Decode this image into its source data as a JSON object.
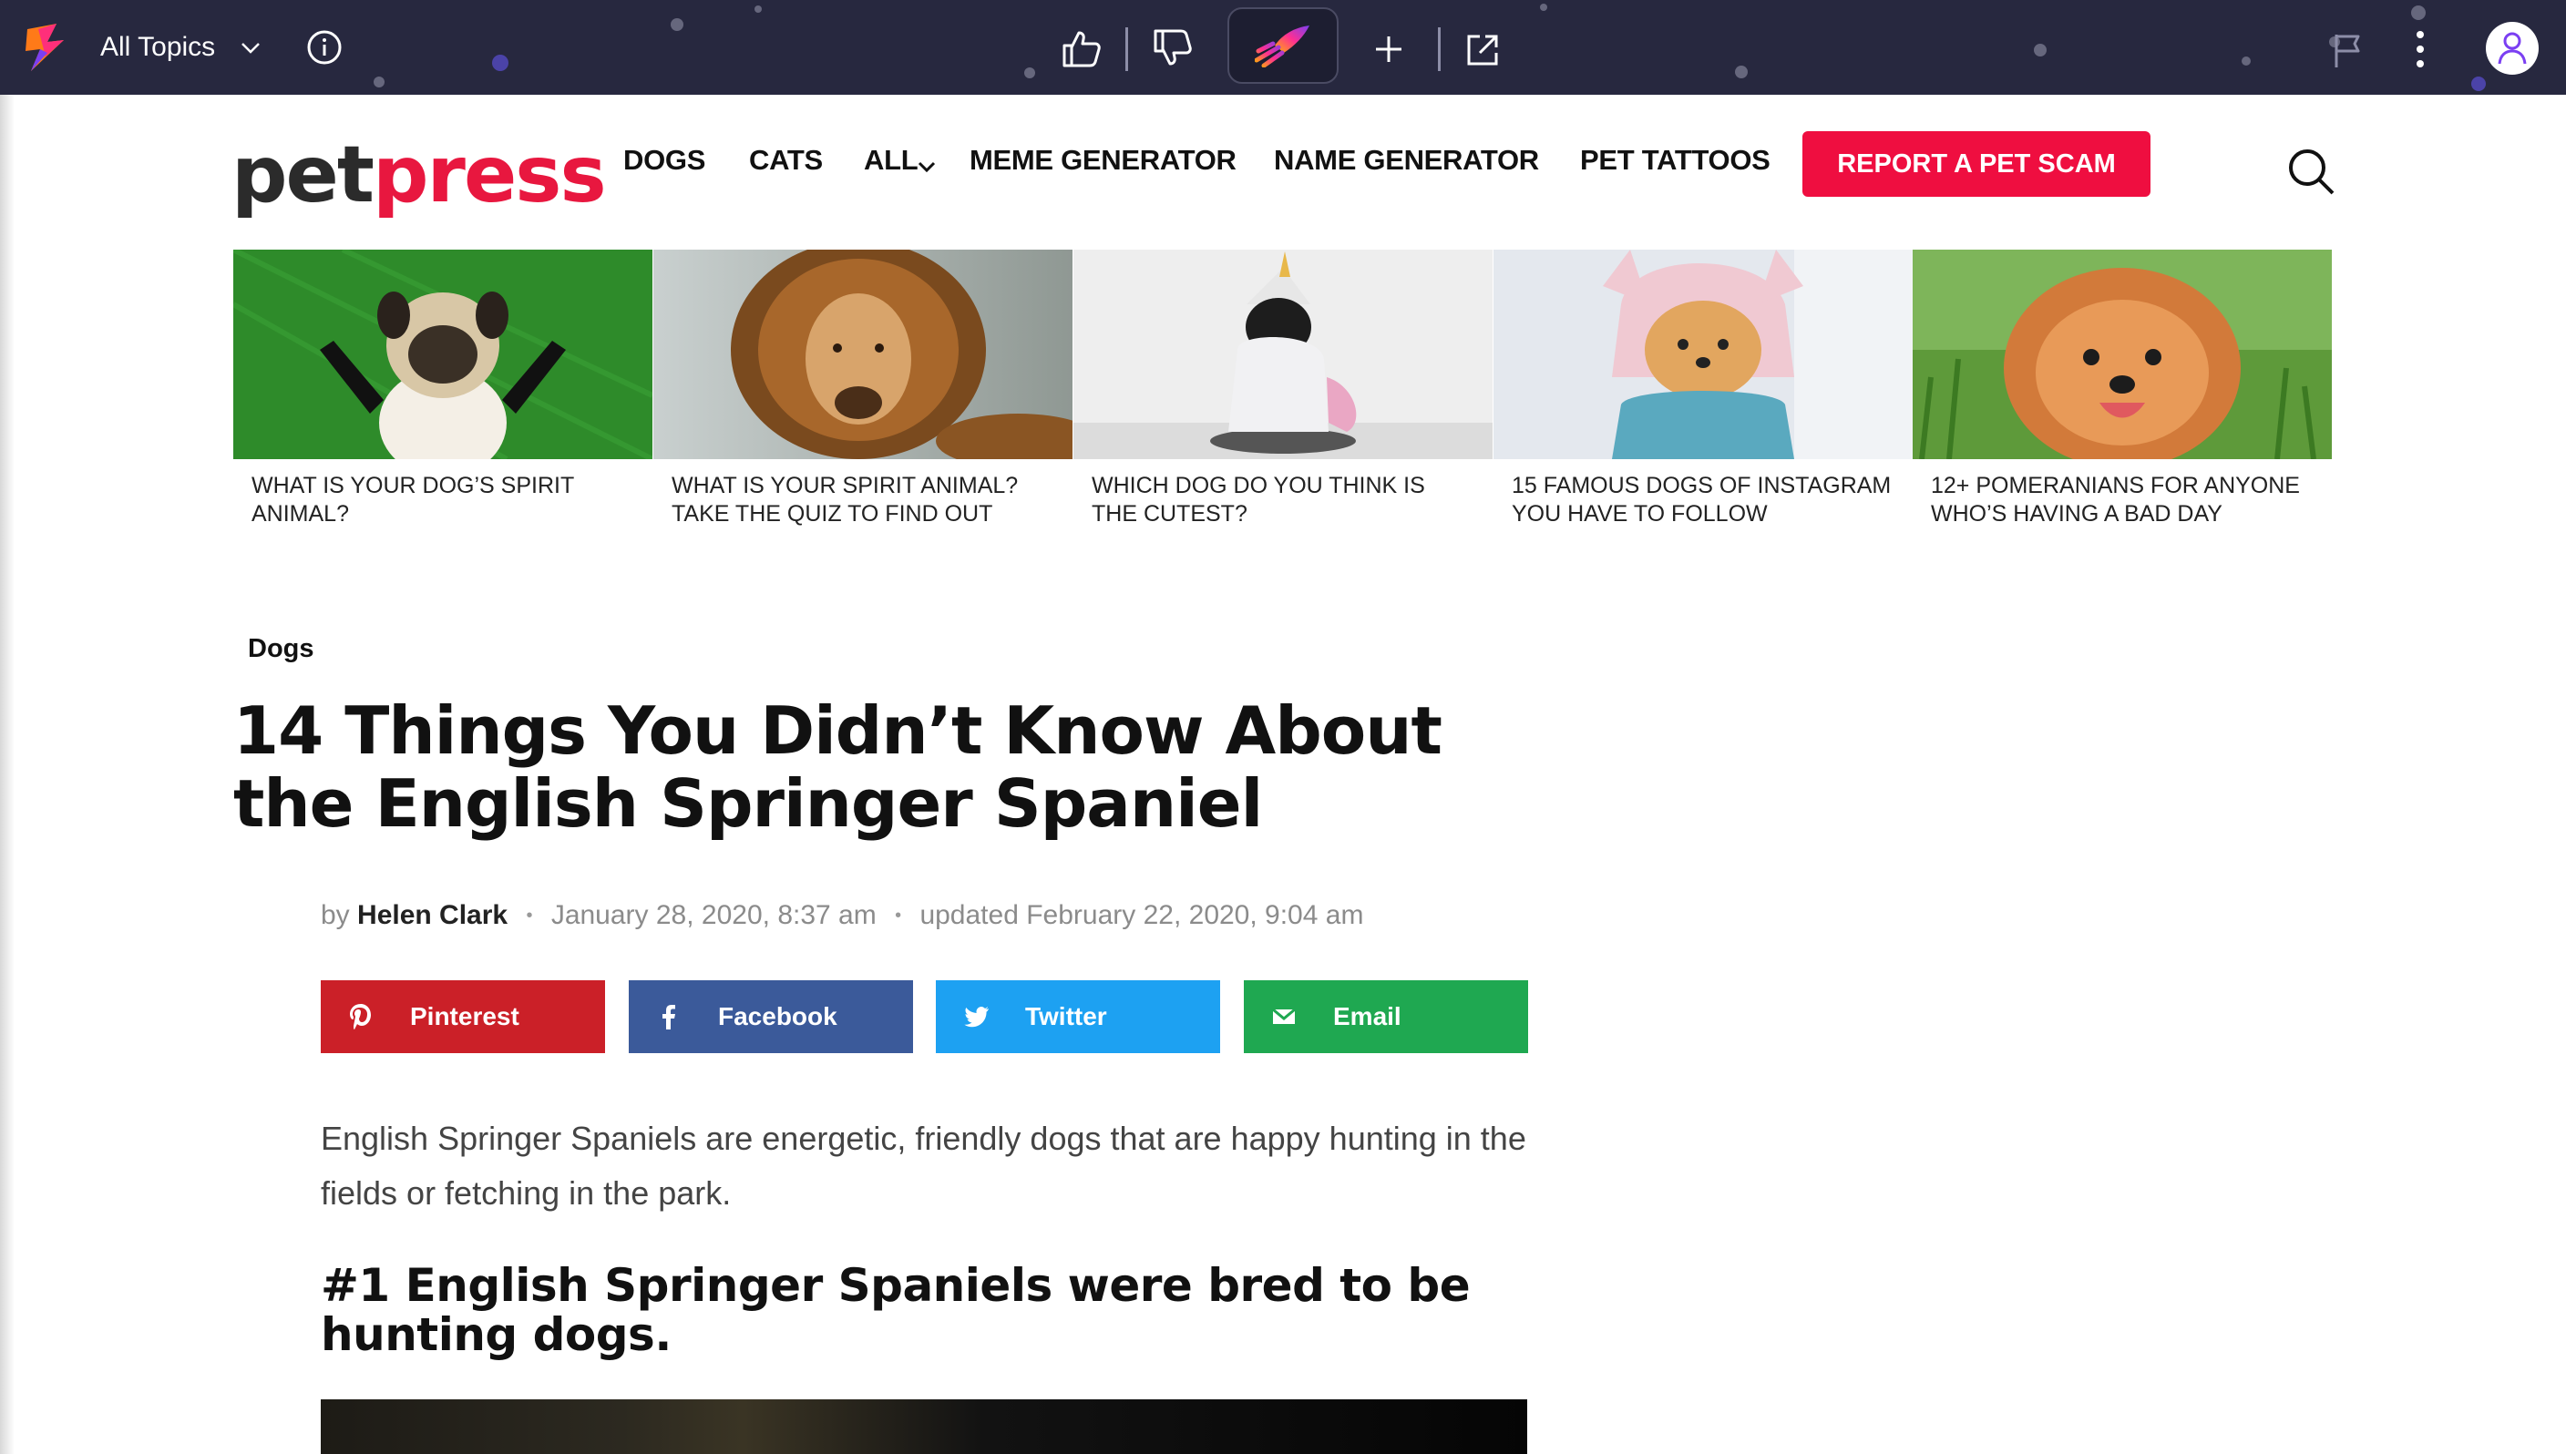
{
  "toolbar": {
    "topics_label": "All Topics",
    "icons": [
      "app-logo-icon",
      "chevron-down-icon",
      "info-icon",
      "thumbs-up-icon",
      "thumbs-down-icon",
      "rocket-icon",
      "plus-icon",
      "open-external-icon",
      "flag-icon",
      "more-vertical-icon",
      "user-avatar-icon"
    ],
    "bg_color": "#27283f"
  },
  "site": {
    "logo_pet": "pet",
    "logo_press": "press",
    "nav": {
      "dogs": "DOGS",
      "cats": "CATS",
      "all": "ALL",
      "meme": "MEME GENERATOR",
      "name": "NAME GENERATOR",
      "tattoos": "PET TATTOOS"
    },
    "cta": "REPORT A PET SCAM",
    "accent_color": "#ef0e40"
  },
  "featured": [
    {
      "caption": "WHAT IS YOUR DOG’S SPIRIT ANIMAL?",
      "image": "pug on grass"
    },
    {
      "caption": "WHAT IS YOUR SPIRIT ANIMAL? TAKE THE QUIZ TO FIND OUT",
      "image": "lion"
    },
    {
      "caption": "WHICH DOG DO YOU THINK IS THE CUTEST?",
      "image": "dog in unicorn costume"
    },
    {
      "caption": "15 FAMOUS DOGS OF INSTAGRAM YOU HAVE TO FOLLOW",
      "image": "pomeranian in bunny hoodie"
    },
    {
      "caption": "12+ POMERANIANS FOR ANYONE WHO’S HAVING A BAD DAY",
      "image": "pomeranian on grass"
    }
  ],
  "article": {
    "category": "Dogs",
    "title": "14 Things You Didn’t Know About the English Springer Spaniel",
    "by": "by",
    "author": "Helen Clark",
    "published": "January 28, 2020, 8:37 am",
    "updated": "updated February 22, 2020, 9:04 am",
    "share": {
      "pinterest": "Pinterest",
      "facebook": "Facebook",
      "twitter": "Twitter",
      "email": "Email"
    },
    "share_colors": {
      "pinterest": "#cb2028",
      "facebook": "#3b5a9a",
      "twitter": "#1da1f2",
      "email": "#1fa851"
    },
    "intro": "English Springer Spaniels are energetic, friendly dogs that are happy hunting in the fields or fetching in the park.",
    "heading1": "#1 English Springer Spaniels were bred to be hunting dogs."
  }
}
